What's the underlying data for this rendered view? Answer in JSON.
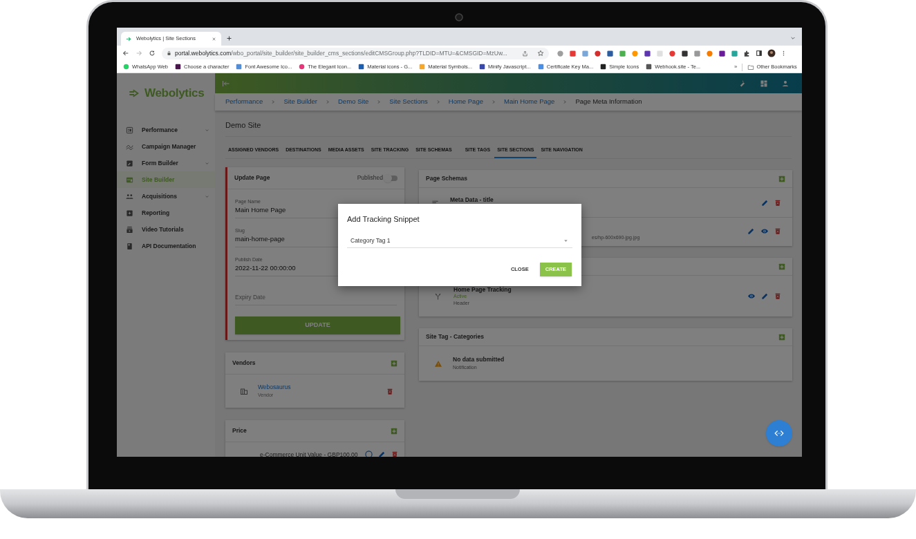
{
  "browser": {
    "tab_title": "Webolytics | Site Sections",
    "url_host": "portal.webolytics.com",
    "url_path": "/wbo_portal/site_builder/site_builder_cms_sections/editCMSGroup.php?TLDID=MTU=&CMSGID=MzUw...",
    "bookmarks": [
      {
        "label": "WhatsApp Web",
        "color": "#25d366"
      },
      {
        "label": "Choose a character",
        "color": "#4a154b"
      },
      {
        "label": "Font Awesome Ico...",
        "color": "#528dd7"
      },
      {
        "label": "The Elegant Icon...",
        "color": "#e8367a"
      },
      {
        "label": "Material icons - G...",
        "color": "#1a5fb4"
      },
      {
        "label": "Material Symbols...",
        "color": "#f9a825"
      },
      {
        "label": "Minify Javascript...",
        "color": "#3949ab"
      },
      {
        "label": "Certificate Key Ma...",
        "color": "#4a8fe7"
      },
      {
        "label": "Simple Icons",
        "color": "#222222"
      },
      {
        "label": "Webhook.site - Te...",
        "color": "#555555"
      }
    ],
    "more": "»",
    "other_bookmarks": "Other Bookmarks"
  },
  "app": {
    "logo": "Webolytics",
    "sidebar": [
      {
        "label": "Performance",
        "selected": false,
        "expandable": true
      },
      {
        "label": "Campaign Manager",
        "selected": false,
        "expandable": false
      },
      {
        "label": "Form Builder",
        "selected": false,
        "expandable": true
      },
      {
        "label": "Site Builder",
        "selected": true,
        "expandable": false
      },
      {
        "label": "Acquisitions",
        "selected": false,
        "expandable": true
      },
      {
        "label": "Reporting",
        "selected": false,
        "expandable": false
      },
      {
        "label": "Video Tutorials",
        "selected": false,
        "expandable": false
      },
      {
        "label": "API Documentation",
        "selected": false,
        "expandable": false
      }
    ],
    "breadcrumbs": [
      {
        "label": "Performance",
        "link": true
      },
      {
        "label": "Site Builder",
        "link": true
      },
      {
        "label": "Demo Site",
        "link": true
      },
      {
        "label": "Site Sections",
        "link": true
      },
      {
        "label": "Home Page",
        "link": true
      },
      {
        "label": "Main Home Page",
        "link": true
      },
      {
        "label": "Page Meta Information",
        "link": false
      }
    ],
    "page_title": "Demo Site",
    "tabs": [
      {
        "label": "ASSIGNED VENDORS",
        "selected": false
      },
      {
        "label": "DESTINATIONS",
        "selected": false
      },
      {
        "label": "MEDIA ASSETS",
        "selected": false
      },
      {
        "label": "SITE TRACKING",
        "selected": false
      },
      {
        "label": "SITE SCHEMAS",
        "selected": false
      },
      {
        "label": "SITE TAGS",
        "selected": false
      },
      {
        "label": "SITE SECTIONS",
        "selected": true
      },
      {
        "label": "SITE NAVIGATION",
        "selected": false
      }
    ],
    "update_card": {
      "title": "Update Page",
      "published_label": "Published",
      "published": false,
      "fields": [
        {
          "label": "Page Name",
          "value": "Main Home Page"
        },
        {
          "label": "Slug",
          "value": "main-home-page"
        },
        {
          "label": "Publish Date",
          "value": "2022-11-22 00:00:00"
        },
        {
          "label": "Expiry Date"
        }
      ],
      "button": "UPDATE"
    },
    "vendors": {
      "title": "Vendors",
      "items": [
        {
          "name": "Webosaurus",
          "type": "Vendor",
          "actions": [
            {
              "kind": "delete"
            }
          ]
        }
      ]
    },
    "price": {
      "title": "Price",
      "items": [
        {
          "name": "e-Commerce Unit Value - GBP100.00",
          "actions": [
            {
              "kind": "info"
            },
            {
              "kind": "edit"
            },
            {
              "kind": "delete"
            }
          ]
        }
      ]
    },
    "page_schemas": {
      "title": "Page Schemas",
      "items": [
        {
          "title": "Meta Data - title",
          "actions": [
            {
              "kind": "edit"
            },
            {
              "kind": "delete"
            }
          ]
        },
        {
          "subtitle": "es/hp-600x690-jpg.jpg",
          "actions": [
            {
              "kind": "edit"
            },
            {
              "kind": "view"
            },
            {
              "kind": "delete"
            }
          ]
        }
      ]
    },
    "tracking": {
      "items": [
        {
          "title": "Home Page Tracking",
          "status": "Active",
          "position": "Header",
          "actions": [
            {
              "kind": "view"
            },
            {
              "kind": "edit"
            },
            {
              "kind": "delete"
            }
          ]
        }
      ]
    },
    "site_tag_categories": {
      "title": "Site Tag - Categories",
      "empty_title": "No data submitted",
      "empty_subtitle": "Notification"
    },
    "modal": {
      "title": "Add Tracking Snippet",
      "select_value": "Category Tag 1",
      "buttons": [
        {
          "label": "CLOSE",
          "kind": "text"
        },
        {
          "label": "CREATE",
          "kind": "primary"
        }
      ]
    }
  }
}
